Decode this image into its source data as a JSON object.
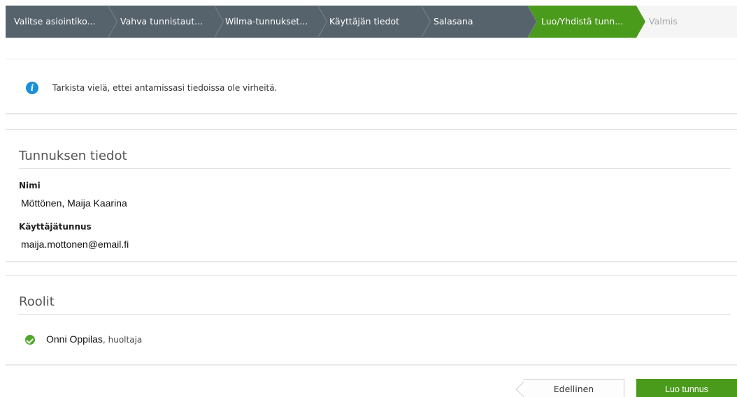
{
  "wizard": {
    "steps": [
      {
        "label": "Valitse asiointiko..."
      },
      {
        "label": "Vahva tunnistaut..."
      },
      {
        "label": "Wilma-tunnukset..."
      },
      {
        "label": "Käyttäjän tiedot"
      },
      {
        "label": "Salasana"
      },
      {
        "label": "Luo/Yhdistä tunn..."
      },
      {
        "label": "Valmis"
      }
    ],
    "active_step": "Luo/Yhdistä tunn...",
    "colors": {
      "done": "#57636c",
      "active": "#4a9a1b",
      "todo": "#a7a7a7"
    }
  },
  "info": {
    "icon": "info-icon",
    "text": "Tarkista vielä, ettei antamissasi tiedoissa ole virheitä."
  },
  "account": {
    "title": "Tunnuksen tiedot",
    "name_label": "Nimi",
    "name_value": "Möttönen, Maija Kaarina",
    "username_label": "Käyttäjätunnus",
    "username_value": "maija.mottonen@email.fi"
  },
  "roles": {
    "title": "Roolit",
    "items": [
      {
        "name": "Onni Oppilas",
        "type": ", huoltaja",
        "icon": "check-circle-icon"
      }
    ]
  },
  "actions": {
    "previous_label": "Edellinen",
    "create_label": "Luo tunnus"
  }
}
